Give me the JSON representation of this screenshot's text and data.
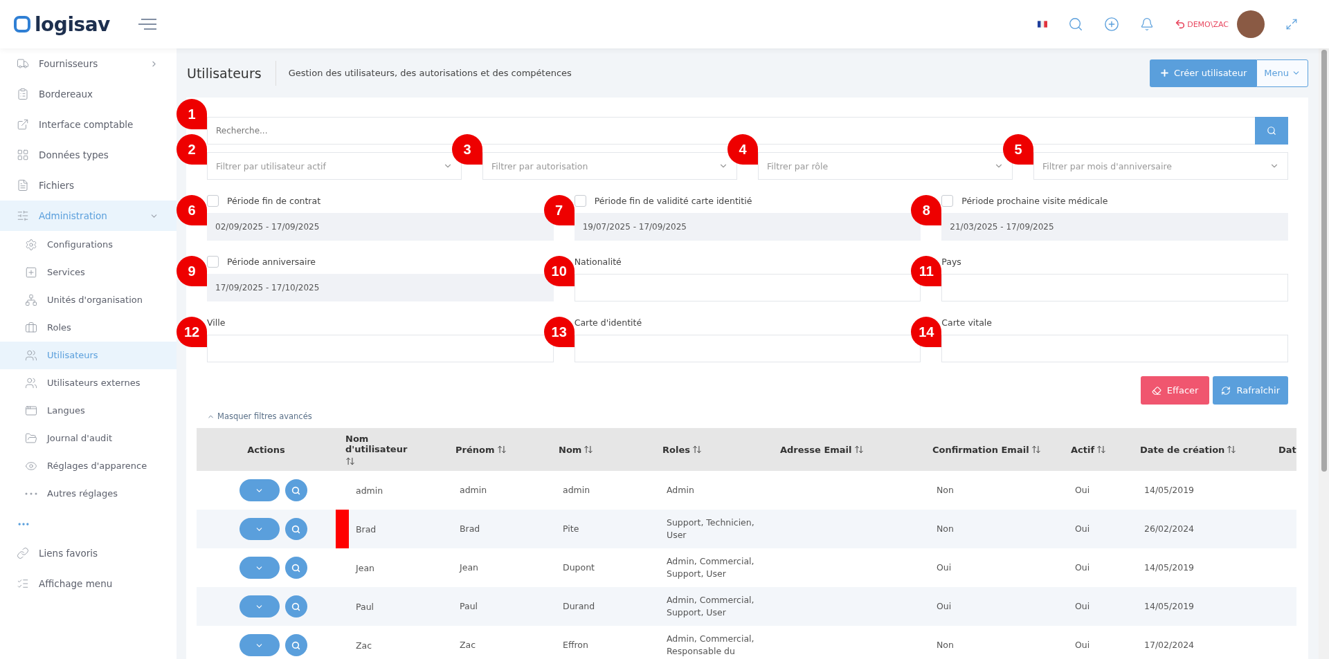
{
  "header": {
    "logo": "logisav",
    "user": "DEMO\\ZAC"
  },
  "sidebar": {
    "items": [
      {
        "label": "Fournisseurs",
        "selected": false,
        "expanded": false
      },
      {
        "label": "Bordereaux",
        "selected": false
      },
      {
        "label": "Interface comptable",
        "selected": false
      },
      {
        "label": "Données types",
        "selected": false
      },
      {
        "label": "Fichiers",
        "selected": false
      },
      {
        "label": "Administration",
        "selected": true,
        "expanded": true,
        "children": [
          {
            "label": "Configurations",
            "selected": false
          },
          {
            "label": "Services",
            "selected": false
          },
          {
            "label": "Unités d'organisation",
            "selected": false
          },
          {
            "label": "Roles",
            "selected": false
          },
          {
            "label": "Utilisateurs",
            "selected": true
          },
          {
            "label": "Utilisateurs externes",
            "selected": false
          },
          {
            "label": "Langues",
            "selected": false
          },
          {
            "label": "Journal d'audit",
            "selected": false
          },
          {
            "label": "Réglages d'apparence",
            "selected": false
          },
          {
            "label": "Autres réglages",
            "selected": false
          }
        ]
      }
    ],
    "footer_items": [
      {
        "label": "Liens favoris",
        "selected": false
      },
      {
        "label": "Affichage menu",
        "selected": false
      }
    ]
  },
  "page": {
    "title": "Utilisateurs",
    "subtitle": "Gestion des utilisateurs, des autorisations et des compétences",
    "create_button": "Créer utilisateur",
    "menu_button": "Menu"
  },
  "filters": {
    "search": {
      "placeholder": "Recherche...",
      "callout": "1"
    },
    "selects": [
      {
        "placeholder": "Filtrer par utilisateur actif",
        "callout": "2"
      },
      {
        "placeholder": "Filtrer par autorisation",
        "callout": "3"
      },
      {
        "placeholder": "Filtrer par rôle",
        "callout": "4"
      },
      {
        "placeholder": "Filtrer par mois d'anniversaire",
        "callout": "5"
      }
    ],
    "fields": [
      {
        "kind": "period",
        "label": "Période fin de contrat",
        "checked": false,
        "value": "02/09/2025 - 17/09/2025",
        "callout": "6"
      },
      {
        "kind": "period",
        "label": "Période fin de validité carte identitié",
        "checked": false,
        "value": "19/07/2025 - 17/09/2025",
        "callout": "7"
      },
      {
        "kind": "period",
        "label": "Période prochaine visite médicale",
        "checked": false,
        "value": "21/03/2025 - 17/09/2025",
        "callout": "8"
      },
      {
        "kind": "period",
        "label": "Période anniversaire",
        "checked": false,
        "value": "17/09/2025 - 17/10/2025",
        "callout": "9"
      },
      {
        "kind": "text",
        "label": "Nationalité",
        "callout": "10"
      },
      {
        "kind": "text",
        "label": "Pays",
        "callout": "11"
      },
      {
        "kind": "text",
        "label": "Ville",
        "callout": "12"
      },
      {
        "kind": "text",
        "label": "Carte d'identité",
        "callout": "13"
      },
      {
        "kind": "text",
        "label": "Carte vitale",
        "callout": "14"
      }
    ],
    "clear_button": "Effacer",
    "refresh_button": "Rafraîchir",
    "toggle_link": "Masquer filtres avancés"
  },
  "table": {
    "columns": [
      {
        "label": "Actions",
        "sortable": false
      },
      {
        "label": "Nom d'utilisateur",
        "sortable": true
      },
      {
        "label": "Prénom",
        "sortable": true
      },
      {
        "label": "Nom",
        "sortable": true
      },
      {
        "label": "Roles",
        "sortable": true
      },
      {
        "label": "Adresse Email",
        "sortable": true
      },
      {
        "label": "Confirmation Email",
        "sortable": true
      },
      {
        "label": "Actif",
        "sortable": true
      },
      {
        "label": "Date de création",
        "sortable": true
      },
      {
        "label": "Dat",
        "sortable": false
      }
    ],
    "rows": [
      {
        "username": "admin",
        "first_name": "admin",
        "last_name": "admin",
        "roles": "Admin",
        "email_confirmed": "Non",
        "active": "Oui",
        "created": "14/05/2019"
      },
      {
        "username": "Brad",
        "first_name": "Brad",
        "last_name": "Pite",
        "roles": "Support, Technicien, User",
        "email_confirmed": "Non",
        "active": "Oui",
        "created": "26/02/2024",
        "color": "#ff0000"
      },
      {
        "username": "Jean",
        "first_name": "Jean",
        "last_name": "Dupont",
        "roles": "Admin, Commercial, Support, User",
        "email_confirmed": "Oui",
        "active": "Oui",
        "created": "14/05/2019"
      },
      {
        "username": "Paul",
        "first_name": "Paul",
        "last_name": "Durand",
        "roles": "Admin, Commercial, Support, User",
        "email_confirmed": "Oui",
        "active": "Oui",
        "created": "14/05/2019"
      },
      {
        "username": "Zac",
        "first_name": "Zac",
        "last_name": "Effron",
        "roles": "Admin, Commercial, Responsable du",
        "email_confirmed": "Non",
        "active": "Oui",
        "created": "17/02/2024"
      }
    ]
  }
}
